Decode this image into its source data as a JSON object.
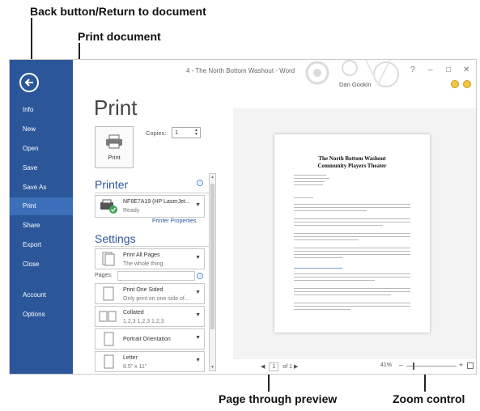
{
  "callouts": {
    "back": "Back button/Return to document",
    "print_doc": "Print document",
    "page_through": "Page through preview",
    "zoom": "Zoom control"
  },
  "window": {
    "title": "4 - The North Bottom Washout - Word",
    "controls": {
      "help": "?",
      "minimize": "–",
      "restore": "□",
      "close": "✕"
    },
    "user": "Dan Gookin"
  },
  "nav": {
    "items": [
      "Info",
      "New",
      "Open",
      "Save",
      "Save As",
      "Print",
      "Share",
      "Export",
      "Close",
      "Account",
      "Options"
    ],
    "active": "Print"
  },
  "print": {
    "heading": "Print",
    "button_label": "Print",
    "copies_label": "Copies:",
    "copies_value": "1"
  },
  "printer": {
    "section": "Printer",
    "name": "NF8E7A19 (HP LaserJet...",
    "status": "Ready",
    "properties_link": "Printer Properties"
  },
  "settings": {
    "section": "Settings",
    "pages_label": "Pages:",
    "pages_value": "",
    "items": [
      {
        "line1": "Print All Pages",
        "line2": "The whole thing"
      },
      {
        "line1": "Print One Sided",
        "line2": "Only print on one side of..."
      },
      {
        "line1": "Collated",
        "line2": "1,2,3   1,2,3   1,2,3"
      },
      {
        "line1": "Portrait Orientation",
        "line2": ""
      },
      {
        "line1": "Letter",
        "line2": "8.5\" x 11\""
      }
    ]
  },
  "preview": {
    "doc_title_1": "The North Bottom Washout",
    "doc_title_2": "Community Players Theater",
    "page_current": "1",
    "page_of": "of 1",
    "zoom": "41%"
  },
  "colors": {
    "nav_bg": "#2b579a",
    "accent": "#2b579a",
    "active_nav": "#3b6fba"
  }
}
